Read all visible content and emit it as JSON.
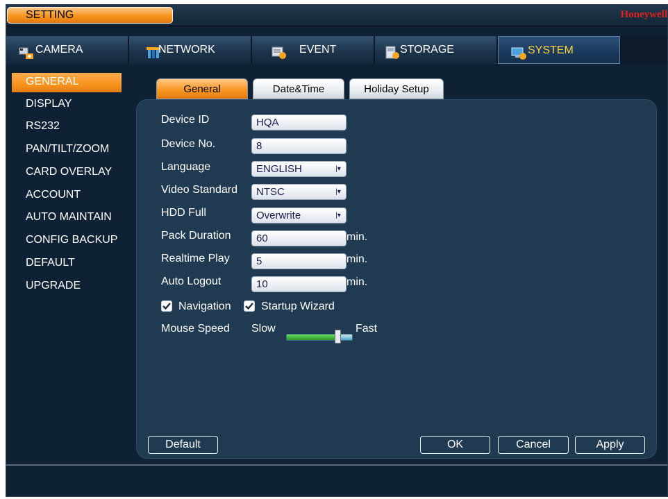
{
  "window": {
    "title": "SETTING",
    "brand": "Honeywell"
  },
  "main_tabs": [
    {
      "label": "CAMERA",
      "icon": "camera-icon"
    },
    {
      "label": "NETWORK",
      "icon": "network-icon"
    },
    {
      "label": "EVENT",
      "icon": "event-icon"
    },
    {
      "label": "STORAGE",
      "icon": "storage-icon"
    },
    {
      "label": "SYSTEM",
      "icon": "system-icon",
      "active": true
    }
  ],
  "sidebar": {
    "items": [
      {
        "label": "GENERAL",
        "active": true
      },
      {
        "label": "DISPLAY"
      },
      {
        "label": "RS232"
      },
      {
        "label": "PAN/TILT/ZOOM"
      },
      {
        "label": "CARD OVERLAY"
      },
      {
        "label": "ACCOUNT"
      },
      {
        "label": "AUTO MAINTAIN"
      },
      {
        "label": "CONFIG BACKUP"
      },
      {
        "label": "DEFAULT"
      },
      {
        "label": "UPGRADE"
      }
    ]
  },
  "sub_tabs": [
    {
      "label": "General",
      "active": true
    },
    {
      "label": "Date&Time"
    },
    {
      "label": "Holiday Setup"
    }
  ],
  "form": {
    "device_id": {
      "label": "Device ID",
      "value": "HQA"
    },
    "device_no": {
      "label": "Device No.",
      "value": "8"
    },
    "language": {
      "label": "Language",
      "value": "ENGLISH"
    },
    "video_standard": {
      "label": "Video Standard",
      "value": "NTSC"
    },
    "hdd_full": {
      "label": "HDD Full",
      "value": "Overwrite"
    },
    "pack_duration": {
      "label": "Pack Duration",
      "value": "60",
      "unit": "min."
    },
    "realtime_play": {
      "label": "Realtime Play",
      "value": "5",
      "unit": "min."
    },
    "auto_logout": {
      "label": "Auto Logout",
      "value": "10",
      "unit": "min."
    },
    "navigation": {
      "label": "Navigation",
      "checked": true
    },
    "startup_wizard": {
      "label": "Startup Wizard",
      "checked": true
    },
    "mouse_speed": {
      "label": "Mouse Speed",
      "min_label": "Slow",
      "max_label": "Fast",
      "level": 0.79
    }
  },
  "buttons": {
    "default": "Default",
    "ok": "OK",
    "cancel": "Cancel",
    "apply": "Apply"
  },
  "colors": {
    "accent": "#f7941d",
    "active_tab_text": "#ffd23c",
    "brand": "#e0201c",
    "background": "#0f2235",
    "panel": "#203a52"
  }
}
